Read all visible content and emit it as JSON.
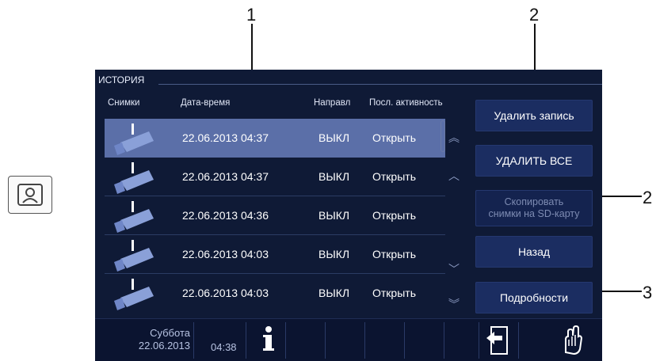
{
  "callouts": {
    "c1": "1",
    "c2a": "2",
    "c2b": "2",
    "c3": "3"
  },
  "header": {
    "title": "ИСТОРИЯ"
  },
  "columns": {
    "snapshots": "Снимки",
    "datetime": "Дата-время",
    "direction": "Направл",
    "activity": "Посл. активность"
  },
  "rows": [
    {
      "datetime": "22.06.2013 04:37",
      "direction": "ВЫКЛ",
      "activity": "Открыть",
      "selected": true
    },
    {
      "datetime": "22.06.2013 04:37",
      "direction": "ВЫКЛ",
      "activity": "Открыть"
    },
    {
      "datetime": "22.06.2013 04:36",
      "direction": "ВЫКЛ",
      "activity": "Открыть"
    },
    {
      "datetime": "22.06.2013 04:03",
      "direction": "ВЫКЛ",
      "activity": "Открыть"
    },
    {
      "datetime": "22.06.2013 04:03",
      "direction": "ВЫКЛ",
      "activity": "Открыть"
    }
  ],
  "buttons": {
    "delete_record": "Удалить запись",
    "delete_all": "УДАЛИТЬ ВСЕ",
    "copy_line1": "Скопировать",
    "copy_line2": "снимки на SD-карту",
    "back": "Назад",
    "details": "Подробности"
  },
  "status": {
    "day": "Суббота",
    "date": "22.06.2013",
    "time": "04:38"
  },
  "icons": {
    "side": "contact-card-icon",
    "info": "info-icon",
    "return": "return-arrow-icon",
    "hand": "hand-touch-icon",
    "scroll_top": "double-chevron-up-icon",
    "scroll_up": "chevron-up-icon",
    "scroll_down": "chevron-down-icon",
    "scroll_bottom": "double-chevron-down-icon"
  },
  "colors": {
    "screen_bg": "#0f1a36",
    "selected_row": "#5b6fa8",
    "button_bg": "#1b2d61"
  }
}
